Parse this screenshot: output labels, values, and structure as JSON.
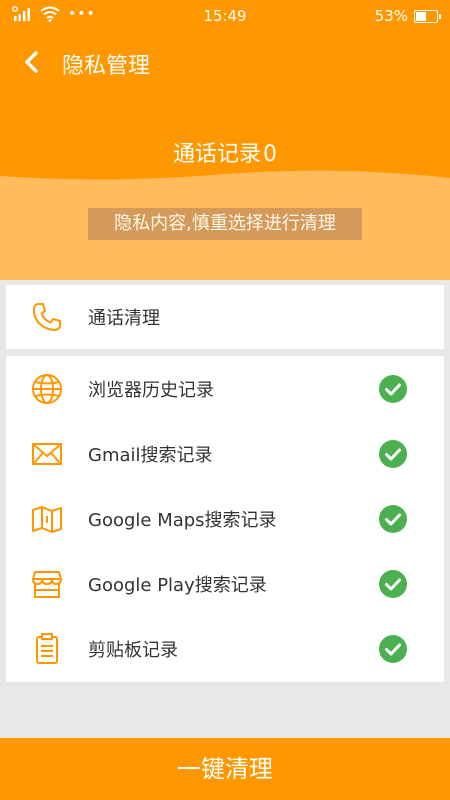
{
  "status_bar": {
    "time": "15:49",
    "battery_percent": "53%",
    "battery_level": 0.53,
    "more_dots": "•••"
  },
  "header": {
    "title": "隐私管理"
  },
  "hero": {
    "call_record_label": "通话记录",
    "call_record_count": "0",
    "warning_text": "隐私内容,慎重选择进行清理"
  },
  "call_card": {
    "label": "通话清理",
    "icon": "phone-icon"
  },
  "items": [
    {
      "label": "浏览器历史记录",
      "icon": "globe-icon",
      "checked": true
    },
    {
      "label": "Gmail搜索记录",
      "icon": "mail-icon",
      "checked": true
    },
    {
      "label": "Google Maps搜索记录",
      "icon": "map-icon",
      "checked": true
    },
    {
      "label": "Google Play搜索记录",
      "icon": "store-icon",
      "checked": true
    },
    {
      "label": "剪贴板记录",
      "icon": "clipboard-icon",
      "checked": true
    }
  ],
  "bottom_button": {
    "label": "一键清理"
  },
  "colors": {
    "accent": "#ff9800",
    "accent_light": "#ffbb5c",
    "check_green": "#4caf50"
  }
}
